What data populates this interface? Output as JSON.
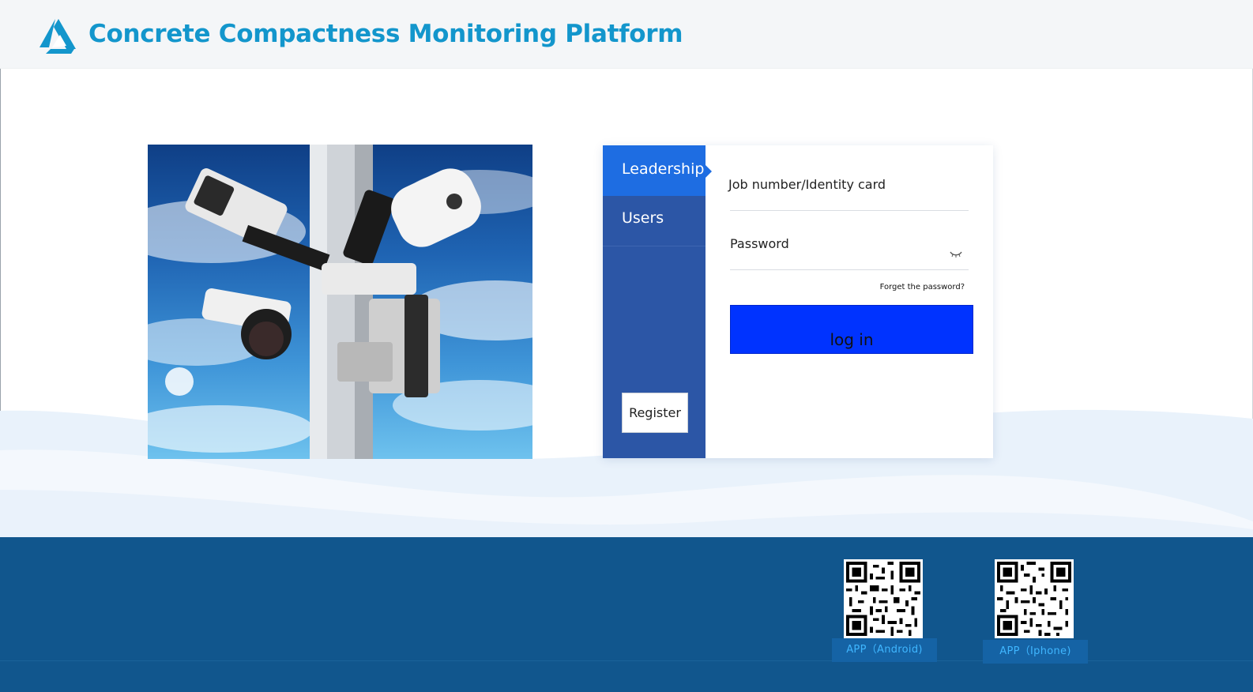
{
  "header": {
    "title": "Concrete Compactness Monitoring Platform",
    "logo_icon": "triangle-logo-icon",
    "brand_color": "#1396cc"
  },
  "hero": {
    "image": "surveillance-cameras-on-pole-photo"
  },
  "login": {
    "tabs": [
      {
        "label": "Leadership",
        "active": true
      },
      {
        "label": "Users",
        "active": false
      }
    ],
    "job_placeholder": "Job number/Identity card",
    "job_value": "",
    "password_placeholder": "Password",
    "password_value": "",
    "eye_icon": "hidden-eye-icon",
    "forgot_label": "Forget the password?",
    "login_label": "log in",
    "register_label": "Register",
    "colors": {
      "sidebar": "#2c56a6",
      "active_tab": "#1e6de2",
      "login_button": "#0033ff"
    }
  },
  "footer": {
    "background": "#11568d",
    "apps": [
      {
        "label": "APP（Android)",
        "qr": "android-qr-code"
      },
      {
        "label": "APP（Iphone)",
        "qr": "iphone-qr-code"
      }
    ]
  }
}
